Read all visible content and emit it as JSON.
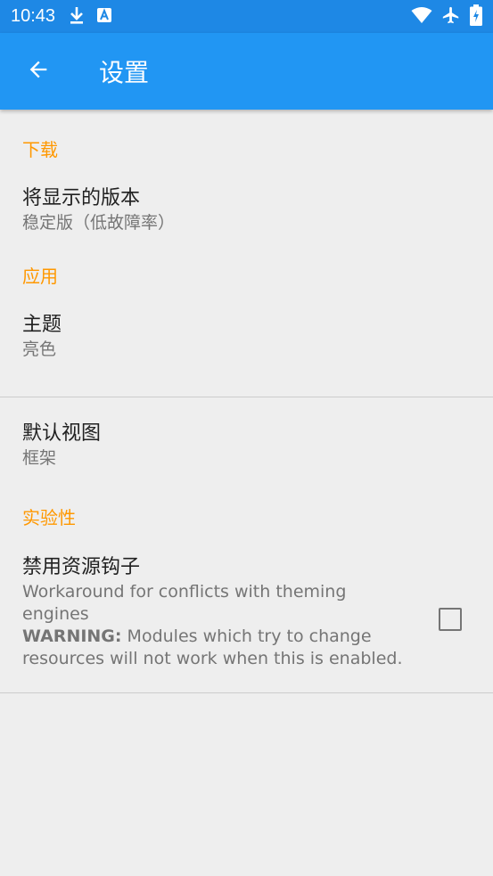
{
  "status_bar": {
    "time": "10:43",
    "left_icons": [
      "download-icon",
      "a-notification-icon"
    ],
    "right_icons": [
      "wifi-icon",
      "airplane-icon",
      "battery-icon"
    ]
  },
  "app_bar": {
    "title": "设置",
    "back_icon": "arrow-back-icon",
    "background": "#2196f3",
    "status_background": "#1e88e5"
  },
  "sections": {
    "download": {
      "header": "下载",
      "version_pref": {
        "title": "将显示的版本",
        "summary": "稳定版（低故障率）"
      }
    },
    "app": {
      "header": "应用",
      "theme_pref": {
        "title": "主题",
        "summary": "亮色"
      },
      "view_pref": {
        "title": "默认视图",
        "summary": "框架"
      }
    },
    "experimental": {
      "header": "实验性",
      "hook_pref": {
        "title": "禁用资源钩子",
        "summary_line": "Workaround for conflicts with theming engines",
        "warning_label": "WARNING:",
        "warning_text": " Modules which try to change resources will not work when this is enabled.",
        "checked": false
      }
    }
  },
  "colors": {
    "accent": "#ff9800",
    "primary_text": "#212121",
    "secondary_text": "#757575",
    "background": "#eeeeee"
  }
}
